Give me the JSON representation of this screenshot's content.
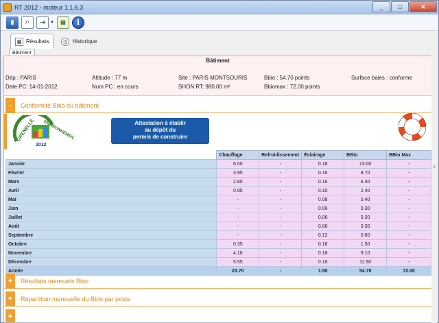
{
  "window": {
    "title": "RT 2012 - moteur 1.1.6.3"
  },
  "tabs": [
    {
      "label": "Résultats"
    },
    {
      "label": "Historique"
    }
  ],
  "subtab": {
    "label": "Bâtiment"
  },
  "batiment": {
    "title": "Bâtiment",
    "dep": "Dép :  PARIS",
    "altitude": "Altitude : 77 m",
    "site": "Site : PARIS MONTSOURIS",
    "bbio": "Bbio : 54.70 points",
    "surface": "Surface baies : conforme",
    "date": "Date PC: 14-01-2012",
    "numpc": "Num PC : en cours",
    "shon": "SHON RT: 980.00 m²",
    "bbiomax": "Bbiomax : 72.00 points"
  },
  "sections": {
    "conformite": "Conformité Bbio du bâtiment",
    "mensuels": "Résultats mensuels Bbio",
    "repartition": "Répartition mensuelle du Bbio par poste"
  },
  "attestation": {
    "line1": "Attestation à établir",
    "line2": "au dépôt du",
    "line3": "permis de construire"
  },
  "logo": {
    "top": "GRENELLE",
    "right": "ENVIRONNEMENT",
    "year": "2012"
  },
  "table": {
    "headers": [
      "Chauffage",
      "Refroidissement",
      "Éclairage",
      "BBio",
      "BBio Max"
    ],
    "rows": [
      {
        "month": "Janvier",
        "c": "6.00",
        "r": "-",
        "e": "0.18",
        "b": "13.00",
        "m": "-"
      },
      {
        "month": "Février",
        "c": "3.95",
        "r": "-",
        "e": "0.16",
        "b": "8.70",
        "m": "-"
      },
      {
        "month": "Mars",
        "c": "2.80",
        "r": "-",
        "e": "0.16",
        "b": "6.40",
        "m": "-"
      },
      {
        "month": "Avril",
        "c": "0.95",
        "r": "-",
        "e": "0.10",
        "b": "2.40",
        "m": "-"
      },
      {
        "month": "Mai",
        "c": "-",
        "r": "-",
        "e": "0.08",
        "b": "0.40",
        "m": "-"
      },
      {
        "month": "Juin",
        "c": "-",
        "r": "-",
        "e": "0.06",
        "b": "0.30",
        "m": "-"
      },
      {
        "month": "Juillet",
        "c": "-",
        "r": "-",
        "e": "0.06",
        "b": "0.30",
        "m": "-"
      },
      {
        "month": "Août",
        "c": "-",
        "r": "-",
        "e": "0.06",
        "b": "0.30",
        "m": "-"
      },
      {
        "month": "Septembre",
        "c": "-",
        "r": "-",
        "e": "0.12",
        "b": "0.60",
        "m": "-"
      },
      {
        "month": "Octobre",
        "c": "0.35",
        "r": "-",
        "e": "0.16",
        "b": "1.50",
        "m": "-"
      },
      {
        "month": "Novembre",
        "c": "4.10",
        "r": "-",
        "e": "0.18",
        "b": "9.10",
        "m": "-"
      },
      {
        "month": "Décembre",
        "c": "5.55",
        "r": "-",
        "e": "0.16",
        "b": "11.90",
        "m": "-"
      },
      {
        "month": "Année",
        "c": "23.70",
        "r": "-",
        "e": "1.50",
        "b": "54.70",
        "m": "72.00"
      }
    ]
  },
  "colors": {
    "accent": "#f0a030",
    "header_bg": "#c6d8ee",
    "value_bg": "#f2d8f4",
    "attest_bg": "#1a5aa8"
  }
}
